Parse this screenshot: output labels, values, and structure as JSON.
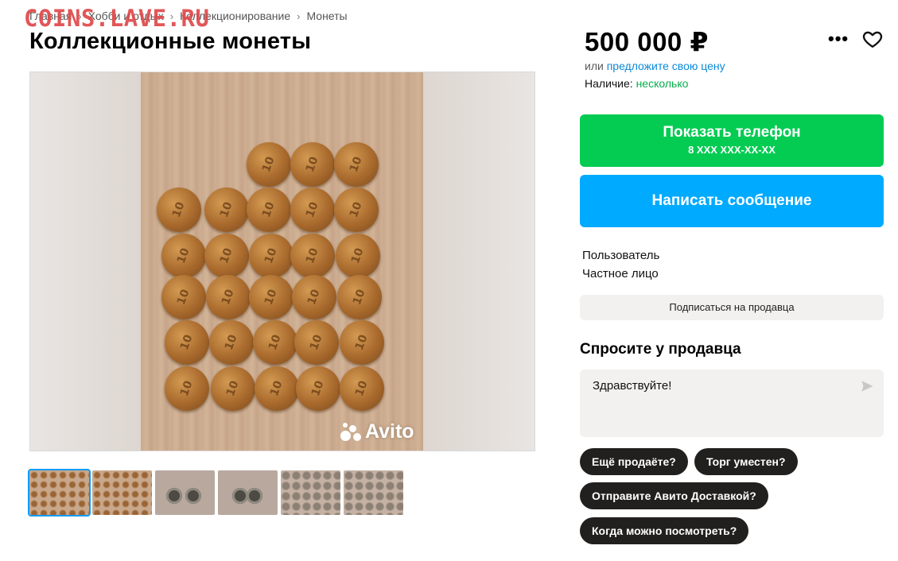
{
  "watermark": "COINS.LAVE.RU",
  "breadcrumbs": [
    "Главная",
    "Хобби и отдых",
    "Коллекционирование",
    "Монеты"
  ],
  "breadcrumb_separator": "›",
  "title": "Коллекционные монеты",
  "gallery": {
    "coin_label": "10",
    "brand": "Avito",
    "thumb_count": 6,
    "active_thumb": 1
  },
  "price": {
    "value": "500 000 ₽",
    "offer_prefix": "или",
    "offer_link": "предложите свою цену",
    "stock_label": "Наличие:",
    "stock_value": "несколько",
    "more_glyph": "•••"
  },
  "buttons": {
    "phone_label": "Показать телефон",
    "phone_sub": "8 XXX XXX-XX-XX",
    "message_label": "Написать сообщение"
  },
  "seller": {
    "name": "Пользователь",
    "type": "Частное лицо",
    "subscribe_label": "Подписаться на продавца"
  },
  "ask": {
    "title": "Спросите у продавца",
    "message_value": "Здравствуйте!",
    "chips": [
      "Ещё продаёте?",
      "Торг уместен?",
      "Отправите Авито Доставкой?",
      "Когда можно посмотреть?"
    ]
  },
  "colors": {
    "phone_button": "#04cc52",
    "message_button": "#00aaff",
    "link": "#0a8ad8",
    "stock_green": "#04b04b",
    "chip": "#22201f",
    "watermark": "#e0484a"
  },
  "icons": [
    "more-icon",
    "heart-icon",
    "send-icon",
    "chevron-right-icon",
    "avito-logo-icon"
  ]
}
